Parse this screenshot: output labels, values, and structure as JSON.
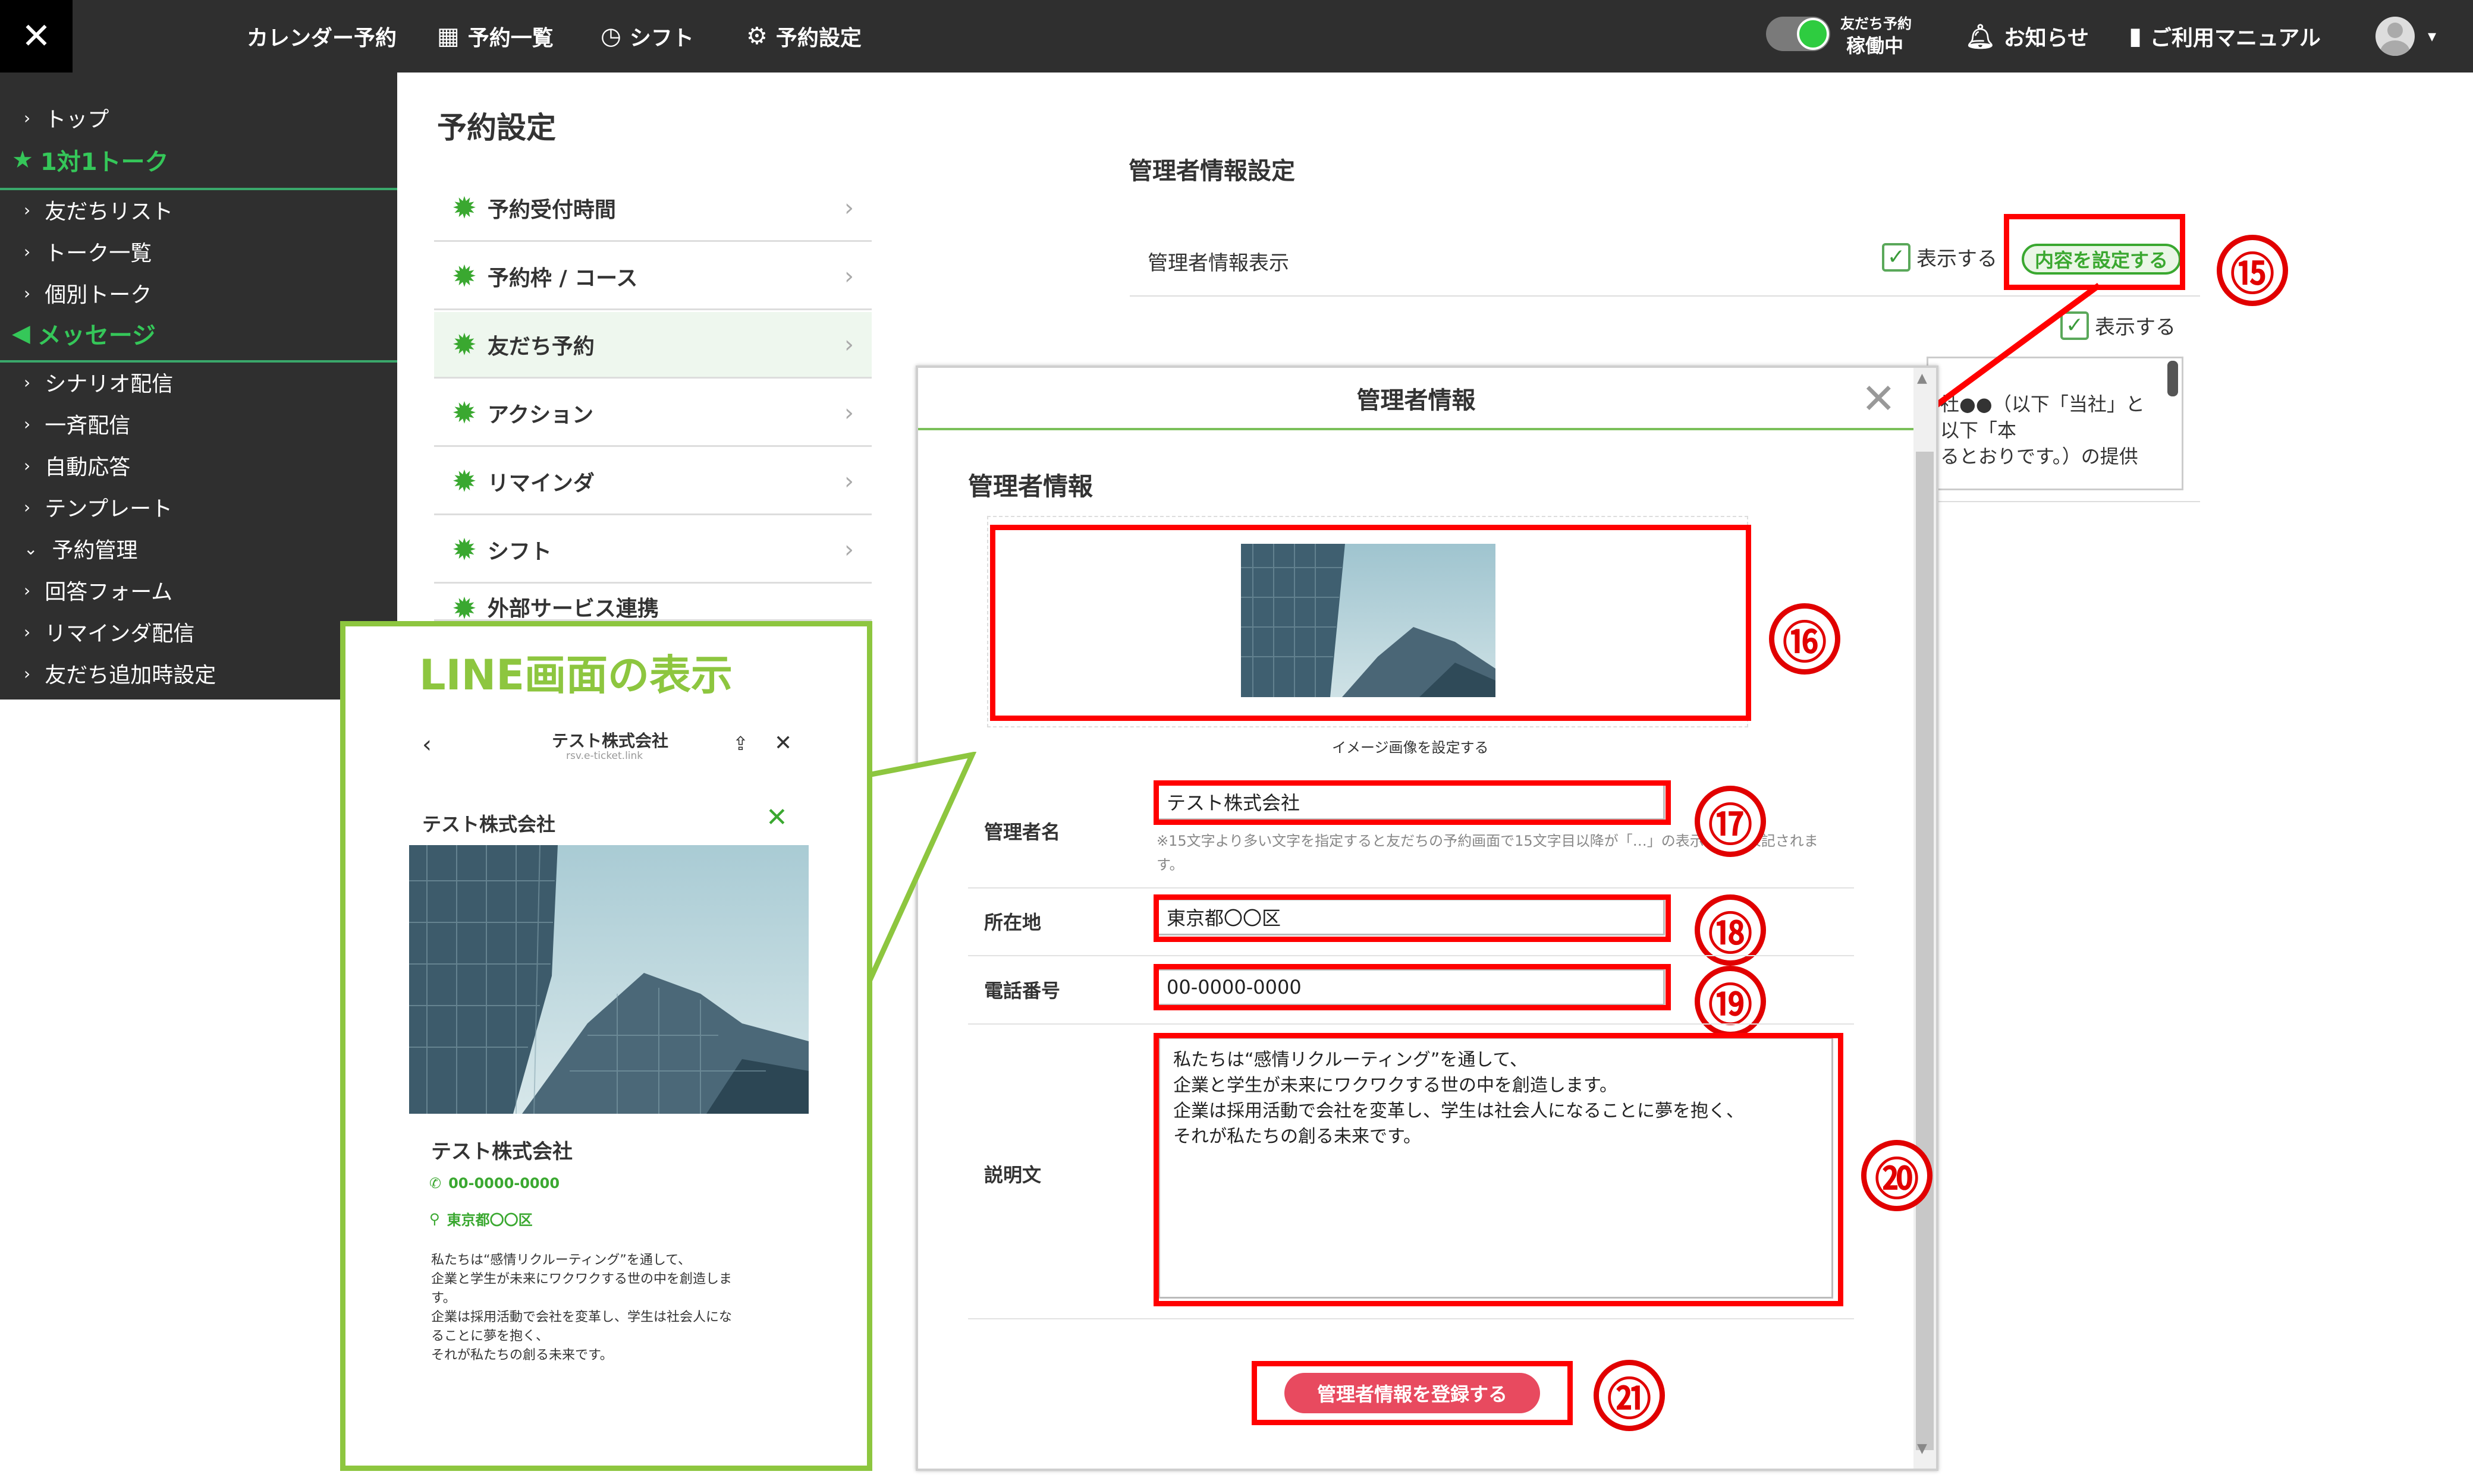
{
  "topbar": {
    "close": "✕",
    "nav": [
      {
        "label": "カレンダー予約"
      },
      {
        "label": "予約一覧",
        "icon": "calendar-icon"
      },
      {
        "label": "シフト",
        "icon": "clock-icon"
      },
      {
        "label": "予約設定",
        "icon": "gear-icon"
      }
    ],
    "friend_status_top": "友だち予約",
    "friend_status_bottom": "稼働中",
    "notice": "お知らせ",
    "manual": "ご利用マニュアル"
  },
  "sidebar": {
    "items_top": [
      "トップ"
    ],
    "section1": "1対1トーク",
    "items_talk": [
      "友だちリスト",
      "トーク一覧",
      "個別トーク"
    ],
    "section2": "メッセージ",
    "items_msg": [
      "シナリオ配信",
      "一斉配信",
      "自動応答",
      "テンプレート",
      "予約管理",
      "回答フォーム",
      "リマインダ配信",
      "友だち追加時設定"
    ]
  },
  "page_title": "予約設定",
  "menu": [
    "予約受付時間",
    "予約枠 / コース",
    "友だち予約",
    "アクション",
    "リマインダ",
    "シフト",
    "外部サービス連携"
  ],
  "settings": {
    "title": "管理者情報設定",
    "row_label": "管理者情報表示",
    "show_label": "表示する",
    "set_button": "内容を設定する",
    "show_label2": "表示する",
    "preview_text": [
      "社●●（以下「当社」と",
      "以下「本",
      "るとおりです。）の提供"
    ]
  },
  "modal": {
    "title": "管理者情報",
    "close": "✕",
    "section_title": "管理者情報",
    "image_caption": "イメージ画像を設定する",
    "name_label": "管理者名",
    "name_value": "テスト株式会社",
    "name_note": "※15文字より多い文字を指定すると友だちの予約画面で15文字目以降が「…」の表示に省略表記されます。",
    "address_label": "所在地",
    "address_value": "東京都〇〇区",
    "phone_label": "電話番号",
    "phone_value": "00-0000-0000",
    "desc_label": "説明文",
    "desc_lines": [
      "私たちは“感情リクルーティング”を通して、",
      "企業と学生が未来にワクワクする世の中を創造します。",
      "企業は採用活動で会社を変革し、学生は社会人になることに夢を抱く、",
      "それが私たちの創る未来です。"
    ],
    "submit": "管理者情報を登録する"
  },
  "annotations": [
    "⑮",
    "⑯",
    "⑰",
    "⑱",
    "⑲",
    "⑳",
    "㉑"
  ],
  "callout": {
    "title": "LINE画面の表示",
    "header_title": "テスト株式会社",
    "header_url": "rsv.e-ticket.link",
    "company": "テスト株式会社",
    "card_name": "テスト株式会社",
    "phone": "00-0000-0000",
    "address": "東京都〇〇区",
    "desc_lines": [
      "私たちは“感情リクルーティング”を通して、",
      "企業と学生が未来にワクワクする世の中を創造しま",
      "す。",
      "企業は採用活動で会社を変革し、学生は社会人にな",
      "ることに夢を抱く、",
      "それが私たちの創る未来です。"
    ]
  },
  "colors": {
    "accent": "#3aa830",
    "annotation_red": "#ff0000",
    "callout_green": "#8dc63f",
    "submit_pink": "#e84a5f"
  }
}
